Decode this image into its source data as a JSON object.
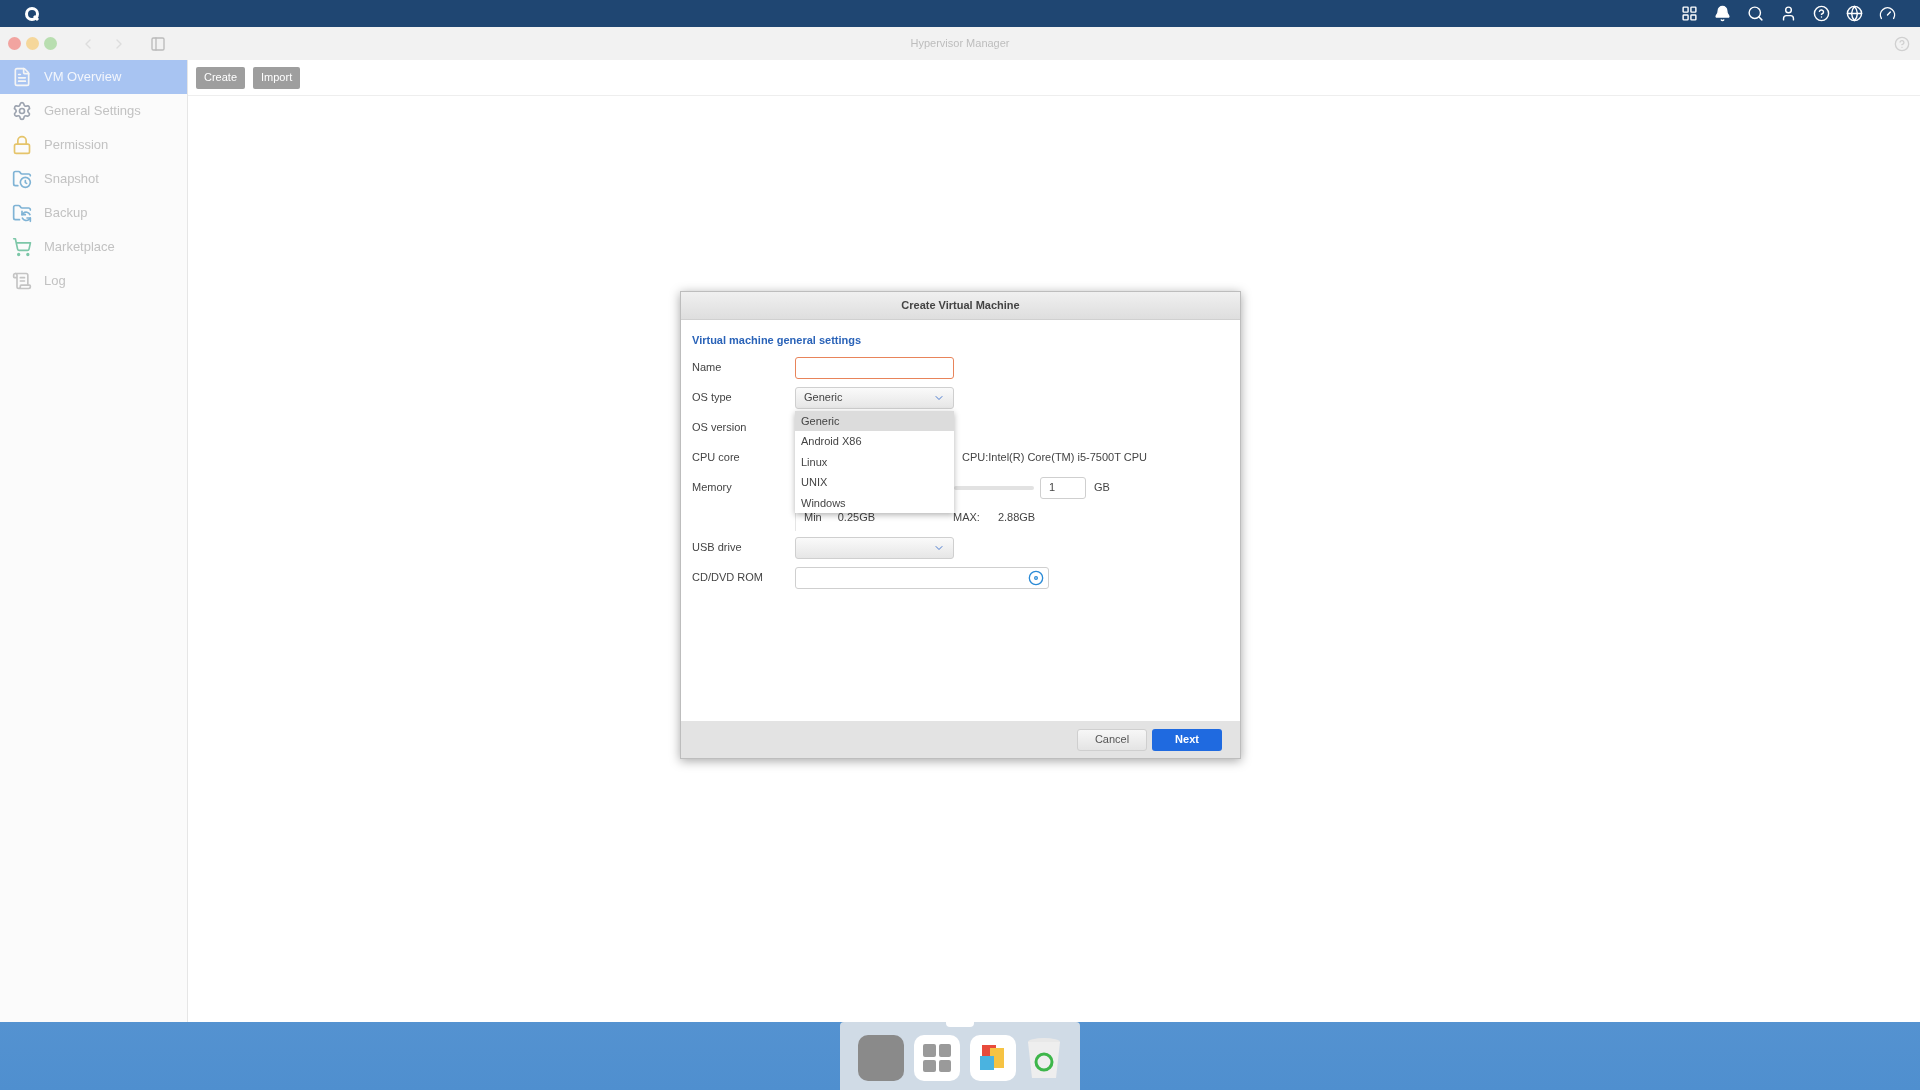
{
  "window": {
    "title": "Hypervisor Manager"
  },
  "sidebar": {
    "items": [
      {
        "label": "VM Overview",
        "kind": "overview",
        "selected": true
      },
      {
        "label": "General Settings",
        "kind": "settings",
        "selected": false
      },
      {
        "label": "Permission",
        "kind": "permission",
        "selected": false
      },
      {
        "label": "Snapshot",
        "kind": "snapshot",
        "selected": false
      },
      {
        "label": "Backup",
        "kind": "backup",
        "selected": false
      },
      {
        "label": "Marketplace",
        "kind": "market",
        "selected": false
      },
      {
        "label": "Log",
        "kind": "log",
        "selected": false
      }
    ]
  },
  "toolbar": {
    "buttons": [
      "Create",
      "Import"
    ]
  },
  "dialog": {
    "title": "Create Virtual Machine",
    "section_title": "Virtual machine general settings",
    "fields": [
      {
        "kind": "text",
        "label": "Name",
        "invalid": true
      },
      {
        "kind": "select",
        "label": "OS type",
        "value": "Generic",
        "options": [
          {
            "label": "Generic",
            "selected": true
          },
          {
            "label": "Android X86",
            "selected": false
          },
          {
            "label": "Linux",
            "selected": false
          },
          {
            "label": "UNIX",
            "selected": false
          },
          {
            "label": "Windows",
            "selected": false
          }
        ]
      },
      {
        "kind": "covered",
        "label": "OS version"
      },
      {
        "kind": "cpu",
        "label": "CPU core",
        "info": "CPU:Intel(R) Core(TM) i5-7500T CPU"
      },
      {
        "kind": "memory",
        "label": "Memory",
        "value": "1",
        "unit": "GB",
        "min_label": "Min",
        "min_value": "0.25GB",
        "max_label": "MAX:",
        "max_value": "2.88GB"
      },
      {
        "kind": "select",
        "label": "USB drive"
      },
      {
        "kind": "file",
        "label": "CD/DVD ROM"
      }
    ],
    "buttons": [
      {
        "label": "Cancel",
        "kind": "secondary"
      },
      {
        "label": "Next",
        "kind": "primary"
      }
    ]
  }
}
